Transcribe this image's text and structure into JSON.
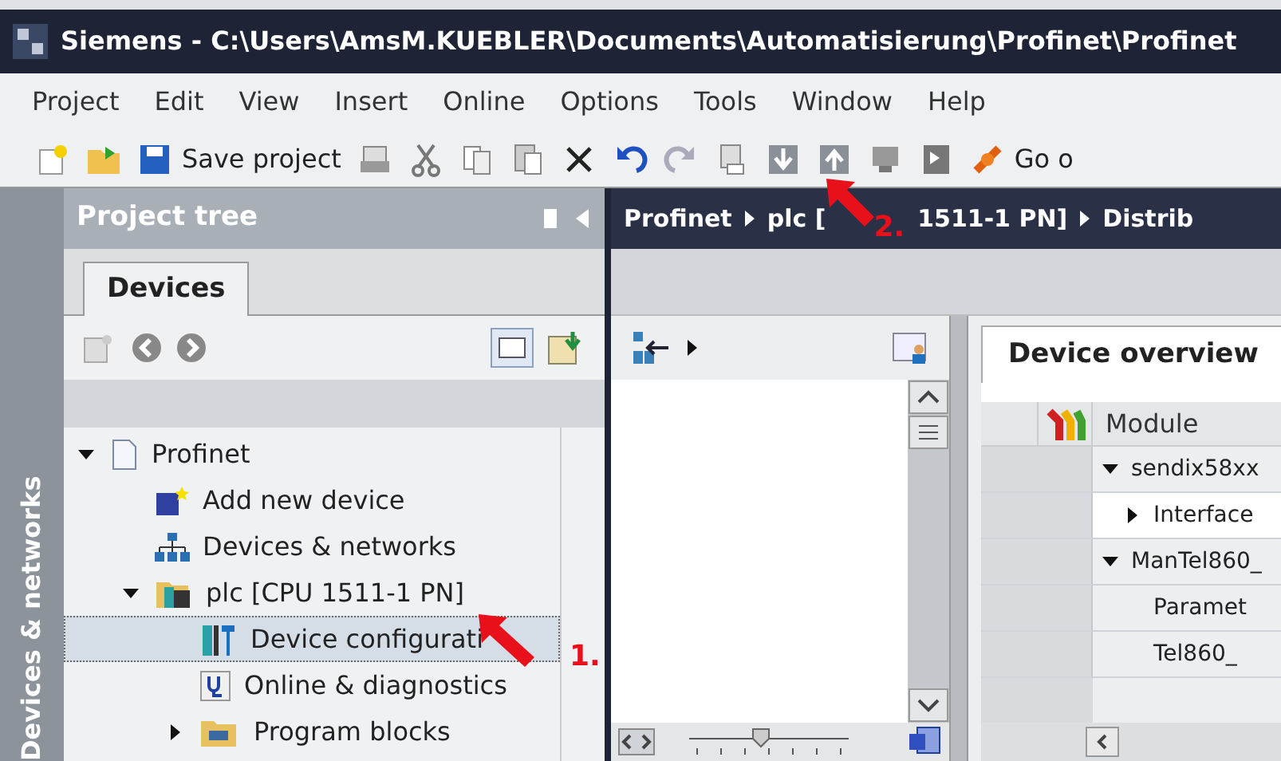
{
  "window": {
    "title": "Siemens  -  C:\\Users\\AmsM.KUEBLER\\Documents\\Automatisierung\\Profinet\\Profinet"
  },
  "menu": [
    "Project",
    "Edit",
    "View",
    "Insert",
    "Online",
    "Options",
    "Tools",
    "Window",
    "Help"
  ],
  "toolbar": {
    "save_label": "Save project",
    "go_label": "Go o"
  },
  "side_tab": "Devices & networks",
  "project_tree": {
    "title": "Project tree",
    "tabs": [
      {
        "label": "Devices",
        "selected": true
      }
    ],
    "items": [
      {
        "label": "Profinet",
        "kind": "project",
        "expanded": true,
        "selected": false,
        "children": [
          {
            "label": "Add new device",
            "kind": "add",
            "selected": false
          },
          {
            "label": "Devices & networks",
            "kind": "network",
            "selected": false
          },
          {
            "label": "plc [CPU 1511-1 PN]",
            "kind": "plc",
            "expanded": true,
            "selected": false,
            "children": [
              {
                "label": "Device configurati",
                "kind": "config",
                "selected": true
              },
              {
                "label": "Online & diagnostics",
                "kind": "online",
                "selected": false
              },
              {
                "label": "Program blocks",
                "kind": "folder",
                "expanded": false,
                "selected": false
              }
            ]
          }
        ]
      }
    ]
  },
  "breadcrumb": [
    {
      "parts": [
        "Profinet"
      ]
    },
    {
      "parts": [
        "plc [",
        "1511-1 PN]"
      ]
    },
    {
      "parts": [
        "Distrib"
      ]
    }
  ],
  "zoom": {
    "level": 0.45
  },
  "device_overview": {
    "tab": "Device overview",
    "column": "Module",
    "rows": [
      {
        "label": "sendix58xx",
        "expanded": true,
        "selected": false,
        "children": [
          {
            "label": "Interface",
            "expanded": false,
            "selected": true
          }
        ]
      },
      {
        "label": "ManTel860_",
        "expanded": true,
        "selected": false,
        "children": [
          {
            "label": "Paramet",
            "selected": false
          },
          {
            "label": "Tel860_",
            "selected": false
          }
        ]
      }
    ]
  },
  "annotations": [
    {
      "label": "1."
    },
    {
      "label": "2."
    }
  ]
}
